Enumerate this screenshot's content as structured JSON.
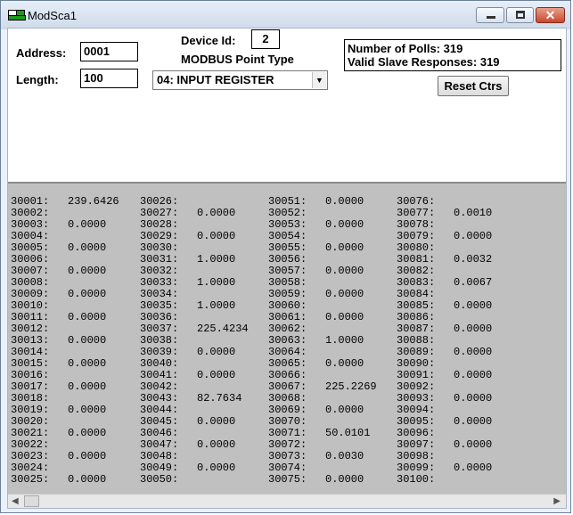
{
  "window": {
    "title": "ModSca1",
    "close_glyph": "✕"
  },
  "form": {
    "address_label": "Address:",
    "address_value": "0001",
    "length_label": "Length:",
    "length_value": "100",
    "device_id_label": "Device Id:",
    "device_id_value": "2",
    "point_type_label": "MODBUS Point Type",
    "point_type_value": "04: INPUT REGISTER",
    "polls_label": "Number of Polls: 319",
    "responses_label": "Valid Slave Responses: 319",
    "reset_label": "Reset Ctrs"
  },
  "registers": {
    "columns": [
      [
        {
          "addr": "30001:",
          "val": "239.6426"
        },
        {
          "addr": "30002:",
          "val": ""
        },
        {
          "addr": "30003:",
          "val": "0.0000"
        },
        {
          "addr": "30004:",
          "val": ""
        },
        {
          "addr": "30005:",
          "val": "0.0000"
        },
        {
          "addr": "30006:",
          "val": ""
        },
        {
          "addr": "30007:",
          "val": "0.0000"
        },
        {
          "addr": "30008:",
          "val": ""
        },
        {
          "addr": "30009:",
          "val": "0.0000"
        },
        {
          "addr": "30010:",
          "val": ""
        },
        {
          "addr": "30011:",
          "val": "0.0000"
        },
        {
          "addr": "30012:",
          "val": ""
        },
        {
          "addr": "30013:",
          "val": "0.0000"
        },
        {
          "addr": "30014:",
          "val": ""
        },
        {
          "addr": "30015:",
          "val": "0.0000"
        },
        {
          "addr": "30016:",
          "val": ""
        },
        {
          "addr": "30017:",
          "val": "0.0000"
        },
        {
          "addr": "30018:",
          "val": ""
        },
        {
          "addr": "30019:",
          "val": "0.0000"
        },
        {
          "addr": "30020:",
          "val": ""
        },
        {
          "addr": "30021:",
          "val": "0.0000"
        },
        {
          "addr": "30022:",
          "val": ""
        },
        {
          "addr": "30023:",
          "val": "0.0000"
        },
        {
          "addr": "30024:",
          "val": ""
        },
        {
          "addr": "30025:",
          "val": "0.0000"
        }
      ],
      [
        {
          "addr": "30026:",
          "val": ""
        },
        {
          "addr": "30027:",
          "val": "0.0000"
        },
        {
          "addr": "30028:",
          "val": ""
        },
        {
          "addr": "30029:",
          "val": "0.0000"
        },
        {
          "addr": "30030:",
          "val": ""
        },
        {
          "addr": "30031:",
          "val": "1.0000"
        },
        {
          "addr": "30032:",
          "val": ""
        },
        {
          "addr": "30033:",
          "val": "1.0000"
        },
        {
          "addr": "30034:",
          "val": ""
        },
        {
          "addr": "30035:",
          "val": "1.0000"
        },
        {
          "addr": "30036:",
          "val": ""
        },
        {
          "addr": "30037:",
          "val": "225.4234"
        },
        {
          "addr": "30038:",
          "val": ""
        },
        {
          "addr": "30039:",
          "val": "0.0000"
        },
        {
          "addr": "30040:",
          "val": ""
        },
        {
          "addr": "30041:",
          "val": "0.0000"
        },
        {
          "addr": "30042:",
          "val": ""
        },
        {
          "addr": "30043:",
          "val": "82.7634"
        },
        {
          "addr": "30044:",
          "val": ""
        },
        {
          "addr": "30045:",
          "val": "0.0000"
        },
        {
          "addr": "30046:",
          "val": ""
        },
        {
          "addr": "30047:",
          "val": "0.0000"
        },
        {
          "addr": "30048:",
          "val": ""
        },
        {
          "addr": "30049:",
          "val": "0.0000"
        },
        {
          "addr": "30050:",
          "val": ""
        }
      ],
      [
        {
          "addr": "30051:",
          "val": "0.0000"
        },
        {
          "addr": "30052:",
          "val": ""
        },
        {
          "addr": "30053:",
          "val": "0.0000"
        },
        {
          "addr": "30054:",
          "val": ""
        },
        {
          "addr": "30055:",
          "val": "0.0000"
        },
        {
          "addr": "30056:",
          "val": ""
        },
        {
          "addr": "30057:",
          "val": "0.0000"
        },
        {
          "addr": "30058:",
          "val": ""
        },
        {
          "addr": "30059:",
          "val": "0.0000"
        },
        {
          "addr": "30060:",
          "val": ""
        },
        {
          "addr": "30061:",
          "val": "0.0000"
        },
        {
          "addr": "30062:",
          "val": ""
        },
        {
          "addr": "30063:",
          "val": "1.0000"
        },
        {
          "addr": "30064:",
          "val": ""
        },
        {
          "addr": "30065:",
          "val": "0.0000"
        },
        {
          "addr": "30066:",
          "val": ""
        },
        {
          "addr": "30067:",
          "val": "225.2269"
        },
        {
          "addr": "30068:",
          "val": ""
        },
        {
          "addr": "30069:",
          "val": "0.0000"
        },
        {
          "addr": "30070:",
          "val": ""
        },
        {
          "addr": "30071:",
          "val": "50.0101"
        },
        {
          "addr": "30072:",
          "val": ""
        },
        {
          "addr": "30073:",
          "val": "0.0030"
        },
        {
          "addr": "30074:",
          "val": ""
        },
        {
          "addr": "30075:",
          "val": "0.0000"
        }
      ],
      [
        {
          "addr": "30076:",
          "val": ""
        },
        {
          "addr": "30077:",
          "val": "0.0010"
        },
        {
          "addr": "30078:",
          "val": ""
        },
        {
          "addr": "30079:",
          "val": "0.0000"
        },
        {
          "addr": "30080:",
          "val": ""
        },
        {
          "addr": "30081:",
          "val": "0.0032"
        },
        {
          "addr": "30082:",
          "val": ""
        },
        {
          "addr": "30083:",
          "val": "0.0067"
        },
        {
          "addr": "30084:",
          "val": ""
        },
        {
          "addr": "30085:",
          "val": "0.0000"
        },
        {
          "addr": "30086:",
          "val": ""
        },
        {
          "addr": "30087:",
          "val": "0.0000"
        },
        {
          "addr": "30088:",
          "val": ""
        },
        {
          "addr": "30089:",
          "val": "0.0000"
        },
        {
          "addr": "30090:",
          "val": ""
        },
        {
          "addr": "30091:",
          "val": "0.0000"
        },
        {
          "addr": "30092:",
          "val": ""
        },
        {
          "addr": "30093:",
          "val": "0.0000"
        },
        {
          "addr": "30094:",
          "val": ""
        },
        {
          "addr": "30095:",
          "val": "0.0000"
        },
        {
          "addr": "30096:",
          "val": ""
        },
        {
          "addr": "30097:",
          "val": "0.0000"
        },
        {
          "addr": "30098:",
          "val": ""
        },
        {
          "addr": "30099:",
          "val": "0.0000"
        },
        {
          "addr": "30100:",
          "val": ""
        }
      ]
    ]
  },
  "scrollbar": {
    "left_arrow": "◀",
    "right_arrow": "▶"
  },
  "icons": {
    "dropdown": "▼"
  }
}
